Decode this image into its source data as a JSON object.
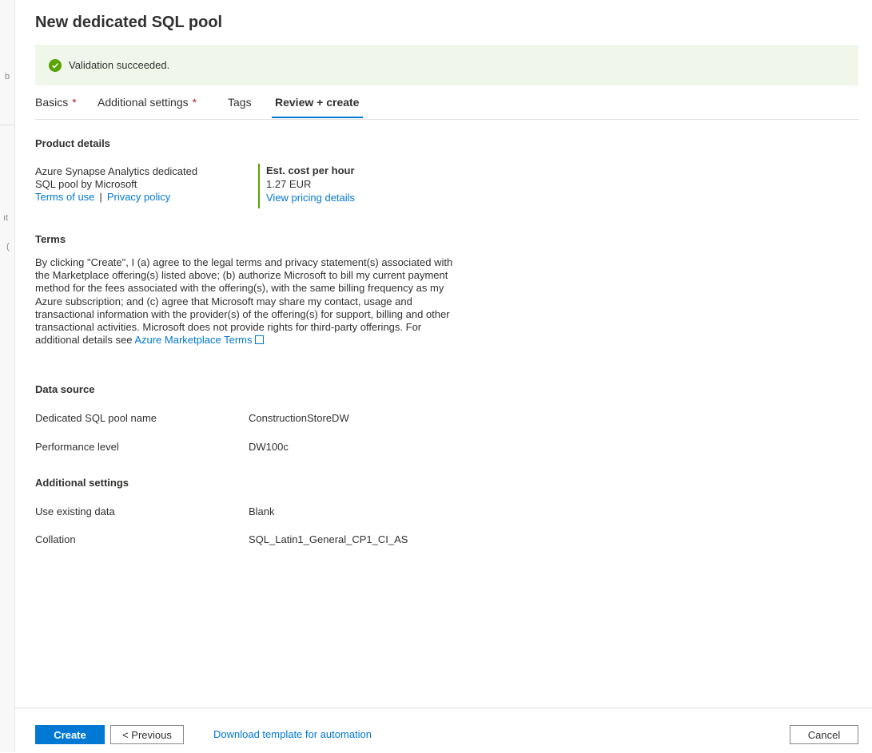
{
  "background_fragments": [
    "b",
    "ıt",
    "("
  ],
  "panel": {
    "title": "New dedicated SQL pool"
  },
  "validation": {
    "message": "Validation succeeded.",
    "icon": "check-circle-icon",
    "color": "#57a300"
  },
  "tabs": [
    {
      "label": "Basics",
      "required": "*"
    },
    {
      "label": "Additional settings",
      "required": "*"
    },
    {
      "label": "Tags"
    },
    {
      "label": "Review + create",
      "active": true
    }
  ],
  "product_details": {
    "heading": "Product details",
    "product_line1": "Azure Synapse Analytics dedicated",
    "product_line2": "SQL pool by Microsoft",
    "terms_of_use": "Terms of use",
    "separator": "|",
    "privacy_policy": "Privacy policy",
    "cost_label": "Est. cost per hour",
    "cost_value": "1.27 EUR",
    "pricing_link": "View pricing details"
  },
  "terms": {
    "heading": "Terms",
    "body": "By clicking \"Create\", I (a) agree to the legal terms and privacy statement(s) associated with the Marketplace offering(s) listed above; (b) authorize Microsoft to bill my current payment method for the fees associated with the offering(s), with the same billing frequency as my Azure subscription; and (c) agree that Microsoft may share my contact, usage and transactional information with the provider(s) of the offering(s) for support, billing and other transactional activities. Microsoft does not provide rights for third-party offerings. For additional details see",
    "link": "Azure Marketplace Terms"
  },
  "data_source": {
    "heading": "Data source",
    "rows": [
      {
        "label": "Dedicated SQL pool name",
        "value": "ConstructionStoreDW"
      },
      {
        "label": "Performance level",
        "value": "DW100c"
      }
    ]
  },
  "additional_settings": {
    "heading": "Additional settings",
    "rows": [
      {
        "label": "Use existing data",
        "value": "Blank"
      },
      {
        "label": "Collation",
        "value": "SQL_Latin1_General_CP1_CI_AS"
      }
    ]
  },
  "footer": {
    "create": "Create",
    "previous": "< Previous",
    "download_link": "Download template for automation",
    "cancel": "Cancel"
  },
  "colors": {
    "accent": "#0078d4",
    "success": "#57a300",
    "required": "#a4262c"
  }
}
